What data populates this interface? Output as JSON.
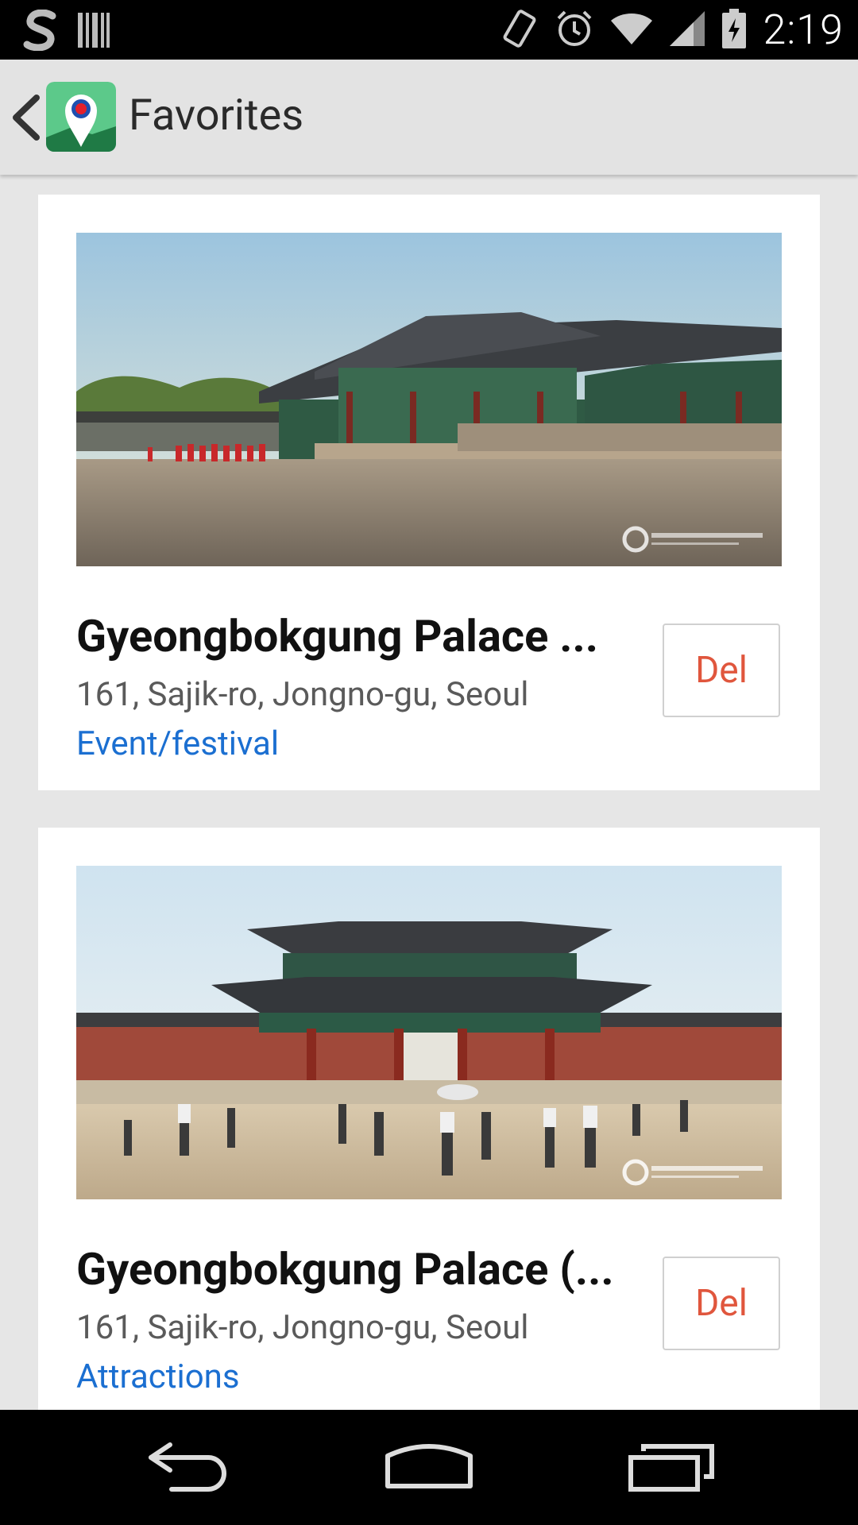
{
  "status_bar": {
    "time": "2:19",
    "left_icons": [
      "simplayer-icon",
      "barcode-icon"
    ],
    "right_icons": [
      "vibrate-icon",
      "alarm-icon",
      "wifi-icon",
      "signal-icon",
      "battery-icon"
    ]
  },
  "app_bar": {
    "title": "Favorites",
    "icons": [
      "back-icon",
      "app-map-pin-icon"
    ]
  },
  "cards": [
    {
      "title": "Gyeongbokgung Palace ...",
      "address": "161, Sajik-ro, Jongno-gu, Seoul",
      "category": "Event/festival",
      "button": "Del"
    },
    {
      "title": "Gyeongbokgung Palace (...",
      "address": "161, Sajik-ro, Jongno-gu, Seoul",
      "category": "Attractions",
      "button": "Del"
    }
  ],
  "nav_bar": {
    "icons": [
      "nav-back-icon",
      "nav-home-icon",
      "nav-recents-icon"
    ]
  },
  "colors": {
    "category": "#1b6fd1",
    "del_text": "#e0563d",
    "background": "#e6e6e6"
  }
}
